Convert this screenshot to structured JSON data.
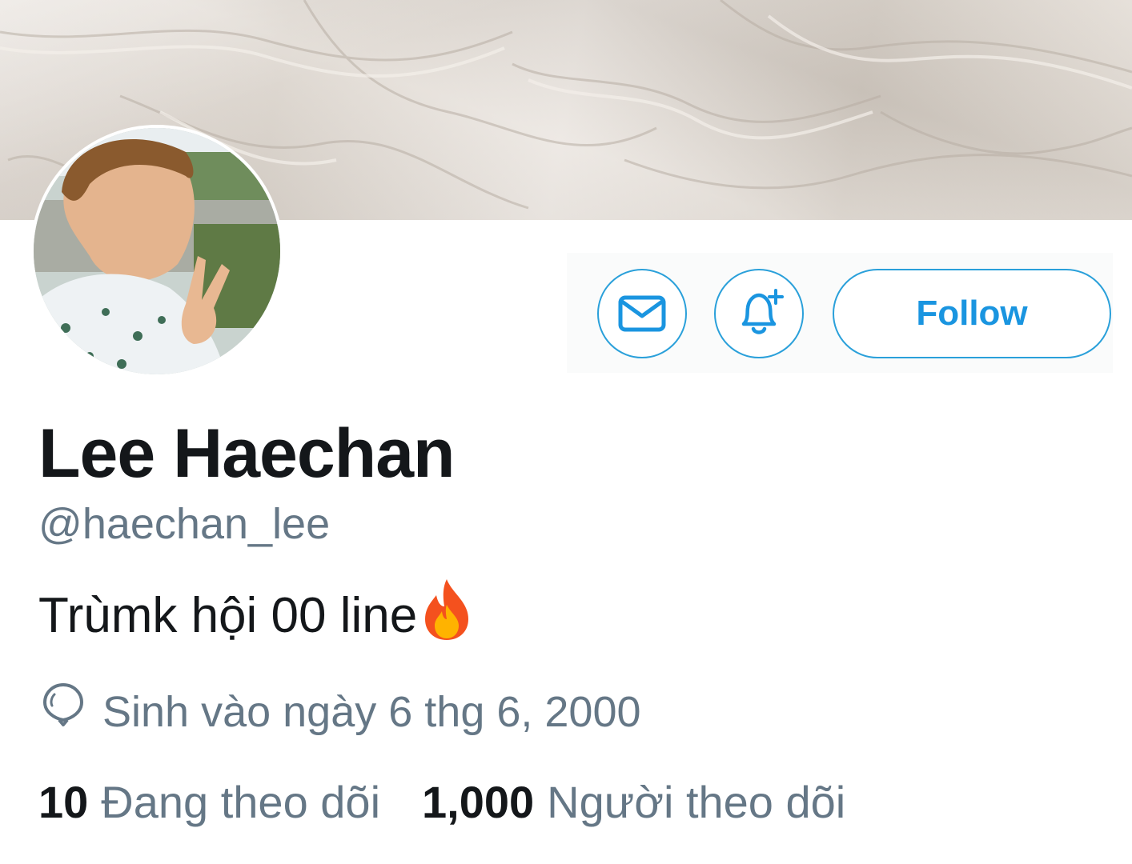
{
  "profile": {
    "name": "Lee Haechan",
    "handle": "@haechan_lee",
    "bio": "Trùmk hội 00 line",
    "bio_emoji": "fire-emoji",
    "birthday": "Sinh vào ngày 6 thg 6, 2000"
  },
  "actions": {
    "message_icon": "envelope-icon",
    "notify_icon": "bell-plus-icon",
    "follow_label": "Follow"
  },
  "stats": {
    "following_count": "10",
    "following_label": "Đang theo dõi",
    "followers_count": "1,000",
    "followers_label": "Người theo dõi"
  },
  "colors": {
    "accent": "#1a95e0",
    "text": "#14171a",
    "muted": "#657786"
  }
}
